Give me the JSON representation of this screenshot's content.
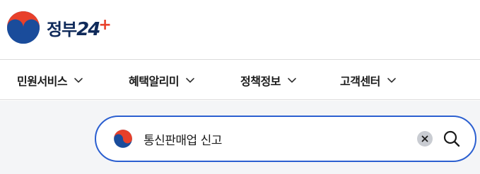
{
  "logo": {
    "text_kr": "정부",
    "text_num": "24",
    "text_plus": "+",
    "colors": {
      "red": "#e8402a",
      "blue": "#1a4c9b",
      "navy": "#0f2a5a"
    }
  },
  "nav": {
    "items": [
      {
        "label": "민원서비스",
        "icon": "chevron-down-icon"
      },
      {
        "label": "혜택알리미",
        "icon": "chevron-down-icon"
      },
      {
        "label": "정책정보",
        "icon": "chevron-down-icon"
      },
      {
        "label": "고객센터",
        "icon": "chevron-down-icon"
      }
    ]
  },
  "search": {
    "value": "통신판매업 신고",
    "icon": "emblem-icon",
    "clear_icon": "close-icon",
    "search_icon": "search-icon",
    "accent": "#2b5fd0"
  }
}
